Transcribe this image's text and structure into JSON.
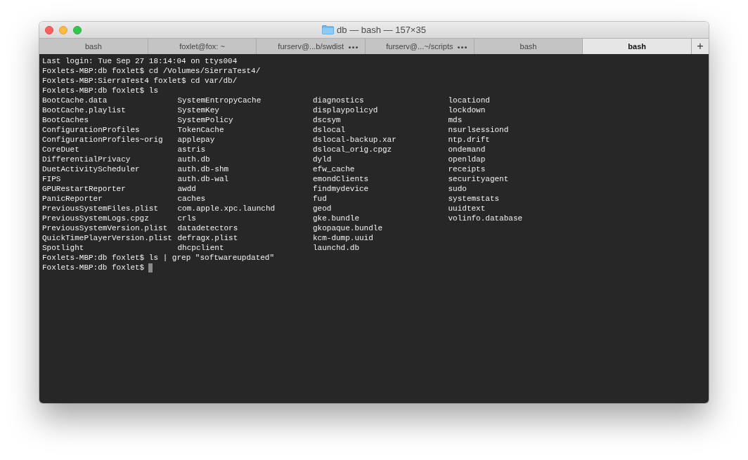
{
  "window": {
    "title": "db — bash — 157×35"
  },
  "tabs": [
    {
      "label": "bash",
      "selected": false,
      "busy": false
    },
    {
      "label": "foxlet@fox: ~",
      "selected": false,
      "busy": false
    },
    {
      "label": "furserv@...b/swdist",
      "selected": false,
      "busy": true
    },
    {
      "label": "furserv@...~/scripts",
      "selected": false,
      "busy": true
    },
    {
      "label": "bash",
      "selected": false,
      "busy": false
    },
    {
      "label": "bash",
      "selected": true,
      "busy": false
    }
  ],
  "new_tab": {
    "label": "+"
  },
  "terminal": {
    "before": [
      "Last login: Tue Sep 27 18:14:04 on ttys004",
      "Foxlets-MBP:db foxlet$ cd /Volumes/SierraTest4/",
      "Foxlets-MBP:SierraTest4 foxlet$ cd var/db/",
      "Foxlets-MBP:db foxlet$ ls"
    ],
    "listing": [
      [
        "BootCache.data",
        "SystemEntropyCache",
        "diagnostics",
        "locationd"
      ],
      [
        "BootCache.playlist",
        "SystemKey",
        "displaypolicyd",
        "lockdown"
      ],
      [
        "BootCaches",
        "SystemPolicy",
        "dscsym",
        "mds"
      ],
      [
        "ConfigurationProfiles",
        "TokenCache",
        "dslocal",
        "nsurlsessiond"
      ],
      [
        "ConfigurationProfiles~orig",
        "applepay",
        "dslocal-backup.xar",
        "ntp.drift"
      ],
      [
        "CoreDuet",
        "astris",
        "dslocal_orig.cpgz",
        "ondemand"
      ],
      [
        "DifferentialPrivacy",
        "auth.db",
        "dyld",
        "openldap"
      ],
      [
        "DuetActivityScheduler",
        "auth.db-shm",
        "efw_cache",
        "receipts"
      ],
      [
        "FIPS",
        "auth.db-wal",
        "emondClients",
        "securityagent"
      ],
      [
        "GPURestartReporter",
        "awdd",
        "findmydevice",
        "sudo"
      ],
      [
        "PanicReporter",
        "caches",
        "fud",
        "systemstats"
      ],
      [
        "PreviousSystemFiles.plist",
        "com.apple.xpc.launchd",
        "geod",
        "uuidtext"
      ],
      [
        "PreviousSystemLogs.cpgz",
        "crls",
        "gke.bundle",
        "volinfo.database"
      ],
      [
        "PreviousSystemVersion.plist",
        "datadetectors",
        "gkopaque.bundle"
      ],
      [
        "QuickTimePlayerVersion.plist",
        "defragx.plist",
        "kcm-dump.uuid"
      ],
      [
        "Spotlight",
        "dhcpclient",
        "launchd.db"
      ]
    ],
    "after": [
      "Foxlets-MBP:db foxlet$ ls | grep \"softwareupdated\""
    ],
    "prompt": "Foxlets-MBP:db foxlet$"
  }
}
